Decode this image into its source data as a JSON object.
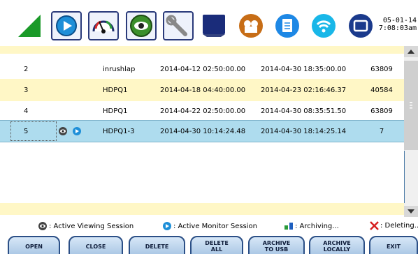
{
  "header": {
    "toolbar_icons": [
      "signal-icon",
      "play-icon",
      "gauge-icon",
      "eye-icon",
      "wrench-icon",
      "monitor-icon",
      "camera-icon",
      "document-icon",
      "wifi-icon",
      "display-icon"
    ],
    "date": "05-01-14",
    "time": "7:08:03am"
  },
  "table": {
    "rows": [
      {
        "idx": "2",
        "name": "inrushlap",
        "start": "2014-04-12 02:50:00.00",
        "end": "2014-04-30 18:35:00.00",
        "count": "63809"
      },
      {
        "idx": "3",
        "name": "HDPQ1",
        "start": "2014-04-18 04:40:00.00",
        "end": "2014-04-23 02:16:46.37",
        "count": "40584"
      },
      {
        "idx": "4",
        "name": "HDPQ1",
        "start": "2014-04-22 02:50:00.00",
        "end": "2014-04-30 08:35:51.50",
        "count": "63809"
      },
      {
        "idx": "5",
        "name": "HDPQ1-3",
        "start": "2014-04-30 10:14:24.48",
        "end": "2014-04-30 18:14:25.14",
        "count": "7"
      }
    ]
  },
  "legend": {
    "viewing": ": Active Viewing Session",
    "monitor": ": Active Monitor Session",
    "archiving": ": Archiving...",
    "deleting": ": Deleting..."
  },
  "buttons": {
    "open": "OPEN",
    "close": "CLOSE",
    "delete": "DELETE",
    "delete_all": "DELETE ALL",
    "archive_usb": "ARCHIVE TO USB",
    "archive_local": "ARCHIVE LOCALLY",
    "exit": "EXIT"
  },
  "colors": {
    "row_alt": "#fff7c6",
    "row_selected": "#aedcee",
    "button_border": "#2b4f86",
    "accent_blue": "#1e88e5"
  }
}
